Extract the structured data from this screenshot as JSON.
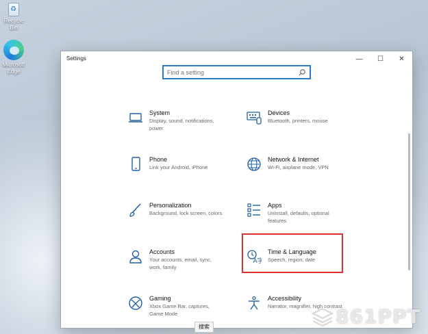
{
  "desktop": {
    "icons": [
      {
        "label": "Recycle Bin"
      },
      {
        "label": "Microsoft Edge"
      }
    ]
  },
  "window": {
    "title": "Settings",
    "controls": {
      "minimize": "—",
      "maximize": "☐",
      "close": "✕"
    }
  },
  "search": {
    "placeholder": "Find a setting"
  },
  "categories": [
    {
      "name": "System",
      "desc": "Display, sound, notifications, power",
      "icon": "laptop-icon"
    },
    {
      "name": "Devices",
      "desc": "Bluetooth, printers, mouse",
      "icon": "keyboard-icon"
    },
    {
      "name": "Phone",
      "desc": "Link your Android, iPhone",
      "icon": "phone-icon"
    },
    {
      "name": "Network & Internet",
      "desc": "Wi-Fi, airplane mode, VPN",
      "icon": "globe-icon"
    },
    {
      "name": "Personalization",
      "desc": "Background, lock screen, colors",
      "icon": "brush-icon"
    },
    {
      "name": "Apps",
      "desc": "Uninstall, defaults, optional features",
      "icon": "apps-list-icon"
    },
    {
      "name": "Accounts",
      "desc": "Your accounts, email, sync, work, family",
      "icon": "person-icon"
    },
    {
      "name": "Time & Language",
      "desc": "Speech, region, date",
      "icon": "time-language-icon"
    },
    {
      "name": "Gaming",
      "desc": "Xbox Game Bar, captures, Game Mode",
      "icon": "xbox-icon"
    },
    {
      "name": "Accessibility",
      "desc": "Narrator, magnifier, high contrast",
      "icon": "accessibility-icon"
    }
  ],
  "highlight_color": "#e0312f",
  "accent_color": "#2a7cc7",
  "taskbar_tooltip": "搜索",
  "watermark": "861PPT"
}
